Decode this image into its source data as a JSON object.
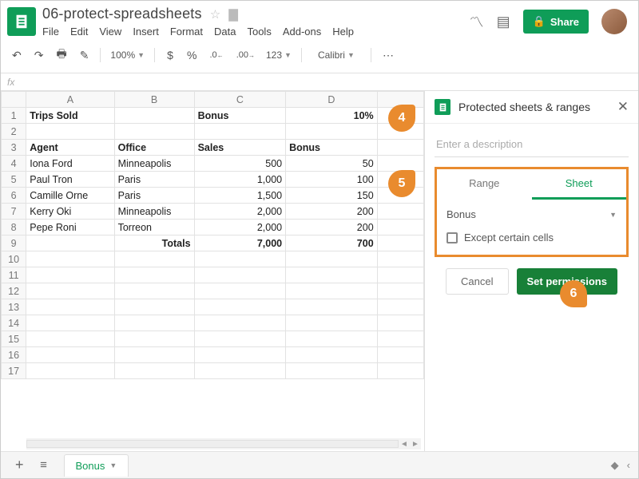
{
  "doc": {
    "title": "06-protect-spreadsheets"
  },
  "menus": [
    "File",
    "Edit",
    "View",
    "Insert",
    "Format",
    "Data",
    "Tools",
    "Add-ons",
    "Help"
  ],
  "share_label": "Share",
  "toolbar": {
    "zoom": "100%",
    "currency": "$",
    "percent": "%",
    "dec_dec": ".0",
    "inc_dec": ".00",
    "numfmt": "123",
    "font": "Calibri"
  },
  "fx_label": "fx",
  "columns": [
    "A",
    "B",
    "C",
    "D",
    ""
  ],
  "rows": [
    {
      "n": 1,
      "a": "Trips Sold",
      "b": "",
      "c": "Bonus",
      "d": "10%",
      "bold": true,
      "d_right": true,
      "c_bold": true
    },
    {
      "n": 2,
      "a": "",
      "b": "",
      "c": "",
      "d": ""
    },
    {
      "n": 3,
      "a": "Agent",
      "b": "Office",
      "c": "Sales",
      "d": "Bonus",
      "bold": true
    },
    {
      "n": 4,
      "a": "Iona Ford",
      "b": "Minneapolis",
      "c": "500",
      "d": "50",
      "num": true
    },
    {
      "n": 5,
      "a": "Paul Tron",
      "b": "Paris",
      "c": "1,000",
      "d": "100",
      "num": true
    },
    {
      "n": 6,
      "a": "Camille Orne",
      "b": "Paris",
      "c": "1,500",
      "d": "150",
      "num": true
    },
    {
      "n": 7,
      "a": "Kerry Oki",
      "b": "Minneapolis",
      "c": "2,000",
      "d": "200",
      "num": true
    },
    {
      "n": 8,
      "a": "Pepe Roni",
      "b": "Torreon",
      "c": "2,000",
      "d": "200",
      "num": true
    },
    {
      "n": 9,
      "a": "",
      "b": "Totals",
      "c": "7,000",
      "d": "700",
      "bold": true,
      "b_right": true,
      "num": true
    },
    {
      "n": 10
    },
    {
      "n": 11
    },
    {
      "n": 12
    },
    {
      "n": 13
    },
    {
      "n": 14
    },
    {
      "n": 15
    },
    {
      "n": 16
    },
    {
      "n": 17
    }
  ],
  "sidebar": {
    "title": "Protected sheets & ranges",
    "desc_placeholder": "Enter a description",
    "tab_range": "Range",
    "tab_sheet": "Sheet",
    "selected_sheet": "Bonus",
    "except_label": "Except certain cells",
    "cancel": "Cancel",
    "set_perm": "Set permissions"
  },
  "footer": {
    "sheet_tab": "Bonus"
  },
  "callouts": {
    "c4": "4",
    "c5": "5",
    "c6": "6"
  }
}
